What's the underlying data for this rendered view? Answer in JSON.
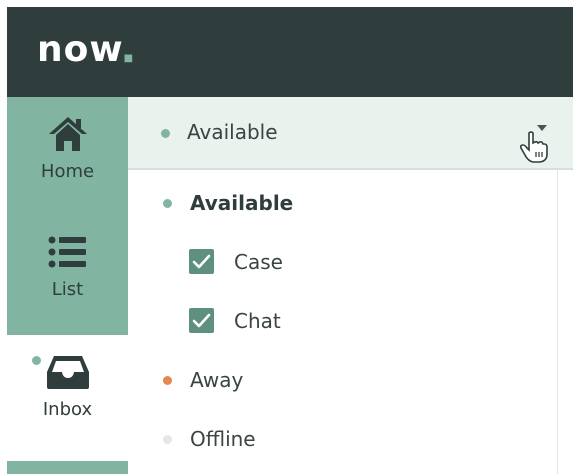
{
  "header": {
    "logo_text": "now"
  },
  "sidebar": {
    "items": [
      {
        "label": "Home",
        "icon": "home-icon"
      },
      {
        "label": "List",
        "icon": "list-icon"
      },
      {
        "label": "Inbox",
        "icon": "inbox-icon"
      }
    ]
  },
  "status": {
    "current": "Available"
  },
  "menu": {
    "options": [
      {
        "label": "Available",
        "color": "#81b5a1"
      },
      {
        "label": "Away",
        "color": "#e08a4f"
      },
      {
        "label": "Offline",
        "color": "#e6e6e6"
      }
    ],
    "channels": [
      {
        "label": "Case",
        "checked": true
      },
      {
        "label": "Chat",
        "checked": true
      }
    ]
  },
  "colors": {
    "brand_dark": "#2f3e3d",
    "accent_green": "#81b5a1",
    "away_orange": "#e08a4f"
  }
}
